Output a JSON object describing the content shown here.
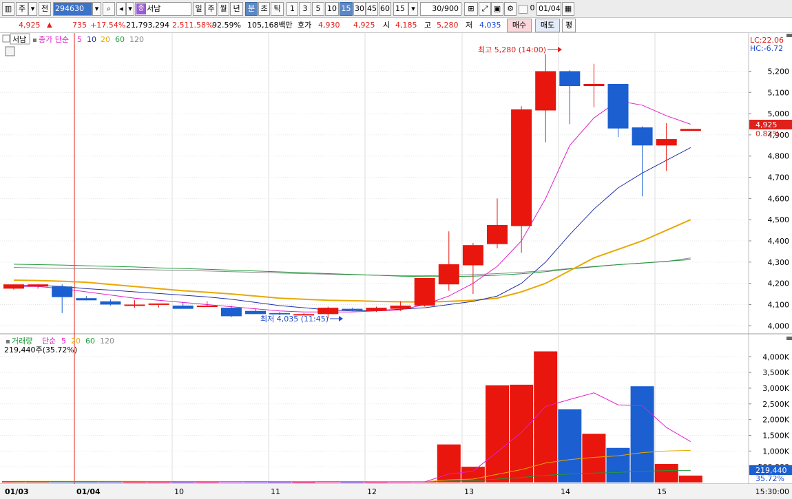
{
  "toolbar": {
    "market": "주",
    "type_label": "전",
    "code": "294630",
    "name_badge": "종",
    "name": "서남",
    "periods": [
      "일",
      "주",
      "월",
      "년",
      "분",
      "초",
      "틱"
    ],
    "active_period": "분",
    "intervals": [
      "1",
      "3",
      "5",
      "10",
      "15",
      "30",
      "45",
      "60"
    ],
    "active_interval": "15",
    "interval_select": "15",
    "count": "30/900",
    "checkbox_label": "0",
    "date": "01/04"
  },
  "quote": {
    "price": "4,925",
    "change_symbol": "▲",
    "change": "735",
    "change_pct": "+17.54%",
    "volume": "21,793,294",
    "volume_ratio": "2,511.58%",
    "turnover_pct": "92.59%",
    "amount": "105,168백만",
    "ask_label": "호가",
    "ask1": "4,930",
    "ask2": "4,925",
    "open_label": "시",
    "open": "4,185",
    "high_label": "고",
    "high": "5,280",
    "low_label": "저",
    "low": "4,035",
    "buy_button": "매수",
    "sell_button": "매도",
    "eval_button": "평"
  },
  "price_panel": {
    "tab": "서남",
    "legend_prefix": "종가 단순",
    "ma_labels": [
      "5",
      "10",
      "20",
      "60",
      "120"
    ],
    "lc": "LC:22.06",
    "hc": "HC:-6.72",
    "current_price": "4,925",
    "current_pct": "0.82%",
    "max_label": "최고 5,280 (14:00)",
    "min_label": "최저 4,035 (11:45)"
  },
  "volume_panel": {
    "legend_name": "거래량",
    "legend_prefix": "단순",
    "ma_labels": [
      "5",
      "20",
      "60",
      "120"
    ],
    "current_text": "219,440주(35.72%)",
    "current_value": "219,440",
    "current_pct": "35.72%"
  },
  "time_axis": {
    "labels": [
      "01/03",
      "01/04",
      "10",
      "11",
      "12",
      "13",
      "14",
      "15"
    ],
    "clock": "15:30:00"
  },
  "colors": {
    "up": "#e8160d",
    "down": "#1b5fd1",
    "ma5": "#e020c8",
    "ma10": "#1e2fa8",
    "ma20": "#e8a800",
    "ma60": "#1f9a3a",
    "ma120": "#8a8a8a"
  },
  "chart_data": [
    {
      "type": "candlestick",
      "title": "서남",
      "y_ticks": [
        4000,
        4100,
        4200,
        4300,
        4400,
        4500,
        4600,
        4700,
        4800,
        4900,
        5000,
        5100,
        5200
      ],
      "y_tick_labels": [
        "4,000",
        "4,100",
        "4,200",
        "4,300",
        "4,400",
        "4,500",
        "4,600",
        "4,700",
        "4,800",
        "4,900",
        "5,000",
        "5,100",
        "5,200"
      ],
      "ylim": [
        3975,
        5315
      ],
      "candles": [
        {
          "o": 4175,
          "h": 4195,
          "l": 4170,
          "c": 4195
        },
        {
          "o": 4185,
          "h": 4195,
          "l": 4175,
          "c": 4195
        },
        {
          "o": 4185,
          "h": 4195,
          "l": 4060,
          "c": 4135
        },
        {
          "o": 4130,
          "h": 4140,
          "l": 4120,
          "c": 4120
        },
        {
          "o": 4115,
          "h": 4125,
          "l": 4095,
          "c": 4100
        },
        {
          "o": 4100,
          "h": 4120,
          "l": 4085,
          "c": 4100
        },
        {
          "o": 4100,
          "h": 4105,
          "l": 4085,
          "c": 4105
        },
        {
          "o": 4095,
          "h": 4110,
          "l": 4080,
          "c": 4080
        },
        {
          "o": 4095,
          "h": 4115,
          "l": 4090,
          "c": 4095
        },
        {
          "o": 4085,
          "h": 4095,
          "l": 4040,
          "c": 4045
        },
        {
          "o": 4070,
          "h": 4080,
          "l": 4055,
          "c": 4055
        },
        {
          "o": 4060,
          "h": 4065,
          "l": 4050,
          "c": 4055
        },
        {
          "o": 4055,
          "h": 4060,
          "l": 4050,
          "c": 4055
        },
        {
          "o": 4055,
          "h": 4090,
          "l": 4035,
          "c": 4085
        },
        {
          "o": 4080,
          "h": 4085,
          "l": 4070,
          "c": 4075
        },
        {
          "o": 4070,
          "h": 4090,
          "l": 4065,
          "c": 4085
        },
        {
          "o": 4080,
          "h": 4115,
          "l": 4070,
          "c": 4095
        },
        {
          "o": 4095,
          "h": 4225,
          "l": 4090,
          "c": 4225
        },
        {
          "o": 4195,
          "h": 4445,
          "l": 4165,
          "c": 4290
        },
        {
          "o": 4285,
          "h": 4390,
          "l": 4150,
          "c": 4380
        },
        {
          "o": 4385,
          "h": 4600,
          "l": 4365,
          "c": 4475
        },
        {
          "o": 4470,
          "h": 5035,
          "l": 4345,
          "c": 5020
        },
        {
          "o": 5015,
          "h": 5280,
          "l": 4865,
          "c": 5200
        },
        {
          "o": 5200,
          "h": 5205,
          "l": 4950,
          "c": 5130
        },
        {
          "o": 5130,
          "h": 5235,
          "l": 5030,
          "c": 5140
        },
        {
          "o": 5140,
          "h": 5140,
          "l": 4890,
          "c": 4930
        },
        {
          "o": 4935,
          "h": 4940,
          "l": 4610,
          "c": 4850
        },
        {
          "o": 4850,
          "h": 4955,
          "l": 4730,
          "c": 4880
        },
        {
          "o": 4925,
          "h": 4925,
          "l": 4925,
          "c": 4925
        }
      ],
      "ma5": [
        4185,
        4185,
        4175,
        4160,
        4145,
        4130,
        4120,
        4110,
        4100,
        4090,
        4080,
        4070,
        4065,
        4065,
        4065,
        4070,
        4075,
        4100,
        4140,
        4200,
        4280,
        4400,
        4600,
        4850,
        4980,
        5060,
        5040,
        4990,
        4950
      ],
      "ma10": [
        4190,
        4190,
        4185,
        4175,
        4168,
        4160,
        4152,
        4144,
        4136,
        4125,
        4110,
        4095,
        4085,
        4075,
        4070,
        4072,
        4078,
        4085,
        4100,
        4115,
        4140,
        4200,
        4300,
        4430,
        4550,
        4650,
        4720,
        4780,
        4840
      ],
      "ma20": [
        4215,
        4213,
        4210,
        4205,
        4195,
        4185,
        4175,
        4165,
        4158,
        4150,
        4140,
        4130,
        4125,
        4120,
        4118,
        4115,
        4113,
        4112,
        4115,
        4120,
        4130,
        4160,
        4200,
        4260,
        4320,
        4360,
        4400,
        4450,
        4500
      ],
      "ma60": [
        4290,
        4288,
        4286,
        4283,
        4280,
        4277,
        4273,
        4270,
        4266,
        4262,
        4258,
        4254,
        4250,
        4246,
        4242,
        4238,
        4234,
        4232,
        4232,
        4234,
        4238,
        4245,
        4255,
        4268,
        4278,
        4288,
        4296,
        4304,
        4312
      ],
      "ma120": [
        4275,
        4273,
        4271,
        4269,
        4267,
        4265,
        4263,
        4261,
        4258,
        4255,
        4252,
        4249,
        4246,
        4243,
        4240,
        4238,
        4236,
        4236,
        4238,
        4241,
        4246,
        4252,
        4260,
        4270,
        4280,
        4288,
        4295,
        4303,
        4320
      ]
    },
    {
      "type": "bar",
      "title": "거래량",
      "y_ticks": [
        500000,
        1000000,
        1500000,
        2000000,
        2500000,
        3000000,
        3500000,
        4000000
      ],
      "y_tick_labels": [
        "500,000",
        "1,000K",
        "1,500K",
        "2,000K",
        "2,500K",
        "3,000K",
        "3,500K",
        "4,000K"
      ],
      "ylim": [
        0,
        4400000
      ],
      "values": [
        40000,
        20000,
        30000,
        20000,
        20000,
        15000,
        15000,
        15000,
        15000,
        30000,
        20000,
        15000,
        12000,
        35000,
        15000,
        15000,
        20000,
        30000,
        1210000,
        500000,
        3090000,
        3110000,
        4170000,
        2330000,
        1550000,
        1100000,
        3060000,
        590000,
        219440
      ],
      "ma5": [
        30000,
        30000,
        28000,
        26000,
        25000,
        22000,
        20000,
        18000,
        17000,
        18000,
        19000,
        18000,
        18000,
        20000,
        20000,
        18000,
        18000,
        20000,
        270000,
        360000,
        970000,
        1590000,
        2420000,
        2640000,
        2850000,
        2470000,
        2440000,
        1750000,
        1300000
      ],
      "ma20": [
        40000,
        40000,
        40000,
        39000,
        38000,
        37000,
        36000,
        35000,
        34000,
        33000,
        33000,
        32000,
        31000,
        30000,
        30000,
        29000,
        28000,
        28000,
        85000,
        110000,
        260000,
        410000,
        620000,
        730000,
        800000,
        850000,
        950000,
        1000000,
        1020000
      ],
      "ma60": [
        25000,
        25000,
        25000,
        25000,
        25000,
        25000,
        25000,
        25000,
        25000,
        25000,
        25000,
        25000,
        25000,
        25000,
        25000,
        25000,
        25000,
        25000,
        45000,
        55000,
        110000,
        160000,
        230000,
        270000,
        300000,
        320000,
        360000,
        380000,
        380000
      ]
    }
  ]
}
